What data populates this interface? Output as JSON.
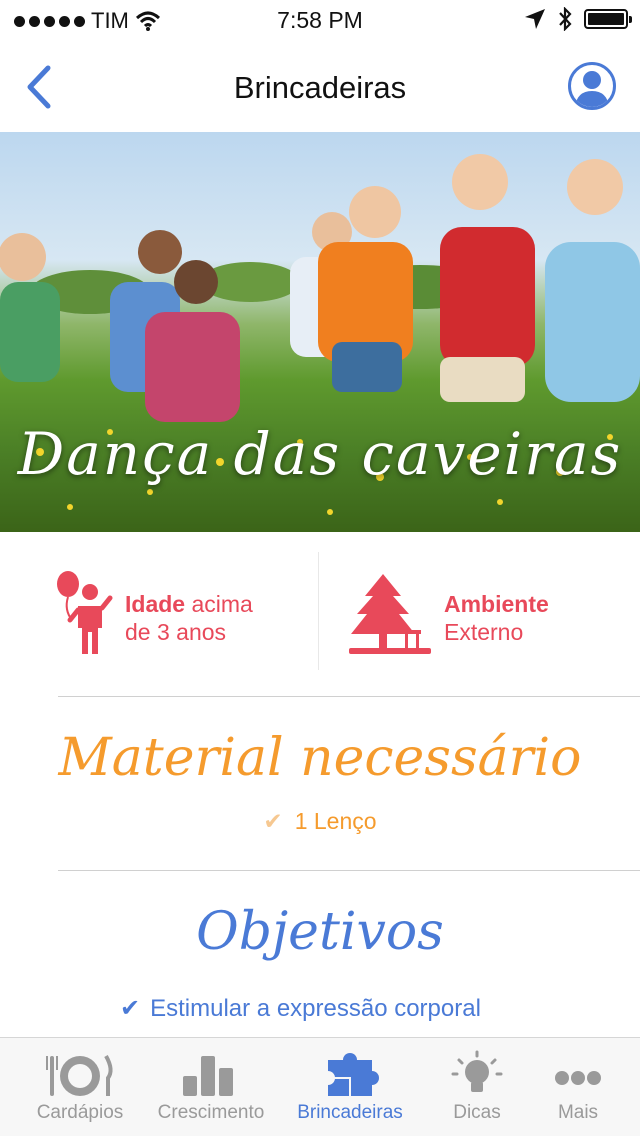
{
  "status_bar": {
    "carrier": "TIM",
    "time": "7:58 PM"
  },
  "navbar": {
    "title": "Brincadeiras"
  },
  "hero": {
    "caption": "Dança das caveiras"
  },
  "info": {
    "age_bold": "Idade",
    "age_rest_line1": " acima",
    "age_line2": "de 3 anos",
    "env_bold": "Ambiente",
    "env_line2": "Externo"
  },
  "material": {
    "title": "Material necessário",
    "items": [
      "1 Lenço"
    ]
  },
  "objectives": {
    "title": "Objetivos",
    "items": [
      "Estimular a expressão corporal"
    ]
  },
  "tabbar": {
    "tabs": [
      {
        "label": "Cardápios"
      },
      {
        "label": "Crescimento"
      },
      {
        "label": "Brincadeiras"
      },
      {
        "label": "Dicas"
      },
      {
        "label": "Mais"
      }
    ],
    "active_index": 2
  },
  "colors": {
    "accent_blue": "#4a7ad6",
    "red": "#e8495a",
    "orange": "#f59b2d"
  }
}
